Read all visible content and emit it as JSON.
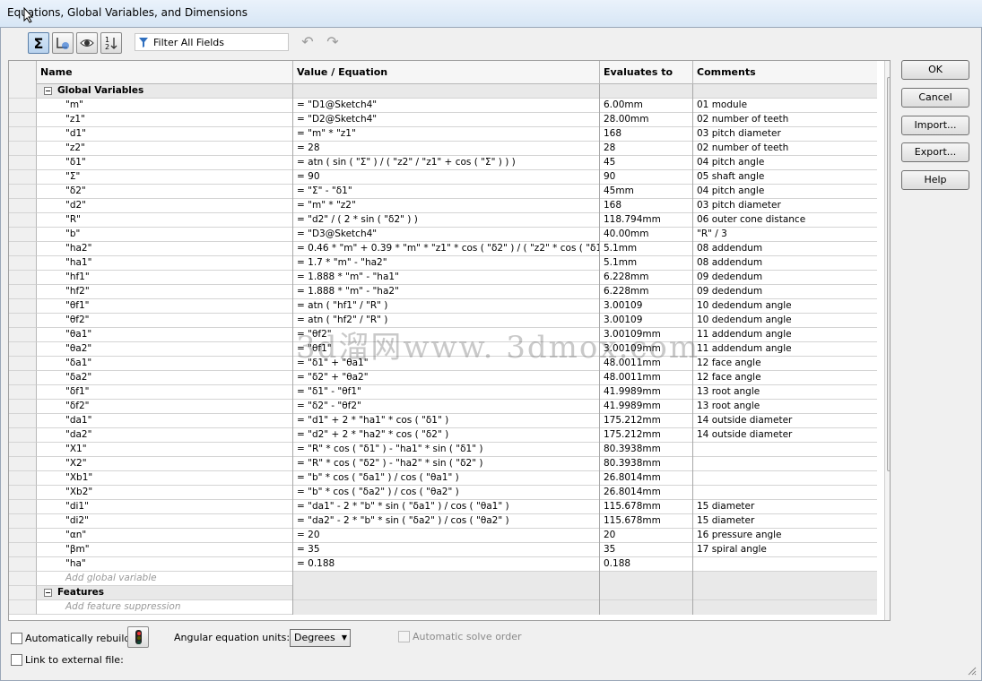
{
  "window": {
    "title": "Equations, Global Variables, and Dimensions"
  },
  "toolbar": {
    "buttons": [
      "equation-view",
      "sketch-equation-view",
      "dimension-view",
      "ordered-view"
    ],
    "filter_placeholder": "Filter All Fields",
    "undo": "undo",
    "redo": "redo"
  },
  "table": {
    "headers": {
      "name": "Name",
      "value": "Value / Equation",
      "evaluates": "Evaluates to",
      "comments": "Comments"
    },
    "group_global": "Global Variables",
    "rows": [
      {
        "name": "\"m\"",
        "value": "= \"D1@Sketch4\"",
        "eval": "6.00mm",
        "comment": "01 module"
      },
      {
        "name": "\"z1\"",
        "value": "= \"D2@Sketch4\"",
        "eval": "28.00mm",
        "comment": "02 number of teeth"
      },
      {
        "name": "\"d1\"",
        "value": "= \"m\" * \"z1\"",
        "eval": "168",
        "comment": "03 pitch diameter"
      },
      {
        "name": "\"z2\"",
        "value": "= 28",
        "eval": "28",
        "comment": "02 number of teeth"
      },
      {
        "name": "\"δ1\"",
        "value": "= atn ( sin ( \"Σ\" ) / ( \"z2\" / \"z1\" + cos ( \"Σ\" ) ) )",
        "eval": "45",
        "comment": "04 pitch angle"
      },
      {
        "name": "\"Σ\"",
        "value": "= 90",
        "eval": "90",
        "comment": "05 shaft angle"
      },
      {
        "name": "\"δ2\"",
        "value": "= \"Σ\" - \"δ1\"",
        "eval": "45mm",
        "comment": "04 pitch angle"
      },
      {
        "name": "\"d2\"",
        "value": "= \"m\" * \"z2\"",
        "eval": "168",
        "comment": "03 pitch diameter"
      },
      {
        "name": "\"R\"",
        "value": "= \"d2\" / ( 2 * sin ( \"δ2\" ) )",
        "eval": "118.794mm",
        "comment": "06 outer cone distance"
      },
      {
        "name": "\"b\"",
        "value": "= \"D3@Sketch4\"",
        "eval": "40.00mm",
        "comment": "\"R\" / 3"
      },
      {
        "name": "\"ha2\"",
        "value": "= 0.46 * \"m\" + 0.39 * \"m\" * \"z1\" * cos ( \"δ2\" ) / ( \"z2\" * cos ( \"δ1\" ) )",
        "eval": "5.1mm",
        "comment": "08 addendum"
      },
      {
        "name": "\"ha1\"",
        "value": "= 1.7 * \"m\" - \"ha2\"",
        "eval": "5.1mm",
        "comment": "08 addendum"
      },
      {
        "name": "\"hf1\"",
        "value": "= 1.888 * \"m\" - \"ha1\"",
        "eval": "6.228mm",
        "comment": "09 dedendum"
      },
      {
        "name": "\"hf2\"",
        "value": "= 1.888 * \"m\" - \"ha2\"",
        "eval": "6.228mm",
        "comment": "09 dedendum"
      },
      {
        "name": "\"θf1\"",
        "value": "= atn ( \"hf1\" / \"R\" )",
        "eval": "3.00109",
        "comment": "10 dedendum angle"
      },
      {
        "name": "\"θf2\"",
        "value": "= atn ( \"hf2\" / \"R\" )",
        "eval": "3.00109",
        "comment": "10 dedendum angle"
      },
      {
        "name": "\"θa1\"",
        "value": "= \"θf2\"",
        "eval": "3.00109mm",
        "comment": "11 addendum angle"
      },
      {
        "name": "\"θa2\"",
        "value": "= \"θf1\"",
        "eval": "3.00109mm",
        "comment": "11 addendum angle"
      },
      {
        "name": "\"δa1\"",
        "value": "= \"δ1\" + \"θa1\"",
        "eval": "48.0011mm",
        "comment": "12 face angle"
      },
      {
        "name": "\"δa2\"",
        "value": "= \"δ2\" + \"θa2\"",
        "eval": "48.0011mm",
        "comment": "12 face angle"
      },
      {
        "name": "\"δf1\"",
        "value": "= \"δ1\" - \"θf1\"",
        "eval": "41.9989mm",
        "comment": "13 root angle"
      },
      {
        "name": "\"δf2\"",
        "value": "= \"δ2\" - \"θf2\"",
        "eval": "41.9989mm",
        "comment": "13 root angle"
      },
      {
        "name": "\"da1\"",
        "value": "= \"d1\" + 2 * \"ha1\" * cos ( \"δ1\" )",
        "eval": "175.212mm",
        "comment": "14 outside diameter"
      },
      {
        "name": "\"da2\"",
        "value": "= \"d2\" + 2 * \"ha2\" * cos ( \"δ2\" )",
        "eval": "175.212mm",
        "comment": "14 outside diameter"
      },
      {
        "name": "\"X1\"",
        "value": "= \"R\" * cos ( \"δ1\" ) - \"ha1\" * sin ( \"δ1\" )",
        "eval": "80.3938mm",
        "comment": ""
      },
      {
        "name": "\"X2\"",
        "value": "= \"R\" * cos ( \"δ2\" ) - \"ha2\" * sin ( \"δ2\" )",
        "eval": "80.3938mm",
        "comment": ""
      },
      {
        "name": "\"Xb1\"",
        "value": "= \"b\" * cos ( \"δa1\" ) / cos ( \"θa1\" )",
        "eval": "26.8014mm",
        "comment": ""
      },
      {
        "name": "\"Xb2\"",
        "value": "= \"b\" * cos ( \"δa2\" ) / cos ( \"θa2\" )",
        "eval": "26.8014mm",
        "comment": ""
      },
      {
        "name": "\"di1\"",
        "value": "= \"da1\" - 2 * \"b\" * sin ( \"δa1\" ) / cos ( \"θa1\" )",
        "eval": "115.678mm",
        "comment": "15  diameter"
      },
      {
        "name": "\"di2\"",
        "value": "= \"da2\" - 2 * \"b\" * sin ( \"δa2\" ) / cos ( \"θa2\" )",
        "eval": "115.678mm",
        "comment": "15  diameter"
      },
      {
        "name": "\"αn\"",
        "value": "= 20",
        "eval": "20",
        "comment": "16 pressure angle"
      },
      {
        "name": "\"βm\"",
        "value": "= 35",
        "eval": "35",
        "comment": "17 spiral angle"
      },
      {
        "name": "\"ha\"",
        "value": "= 0.188",
        "eval": "0.188",
        "comment": ""
      }
    ],
    "add_global_placeholder": "Add global variable",
    "group_features": "Features",
    "add_feature_placeholder": "Add feature suppression"
  },
  "side_buttons": {
    "ok": "OK",
    "cancel": "Cancel",
    "import": "Import...",
    "export": "Export...",
    "help": "Help"
  },
  "bottom": {
    "auto_rebuild": "Automatically rebuild",
    "angular_units_label": "Angular equation units:",
    "angular_units_value": "Degrees",
    "auto_solve": "Automatic solve order",
    "link_external": "Link to external file:"
  },
  "watermark": "3d溜网www. 3dmox.com"
}
